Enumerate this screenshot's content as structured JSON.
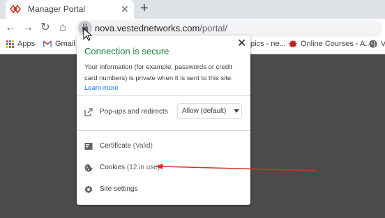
{
  "tab": {
    "title": "Manager Portal",
    "close": "✕"
  },
  "new_tab": "+",
  "toolbar": {
    "back": "←",
    "forward": "→",
    "reload": "↻",
    "home": "⌂"
  },
  "omnibox": {
    "domain": "nova.vestednetworks.com",
    "path": "/portal/"
  },
  "bookmarks": [
    {
      "label": "Apps"
    },
    {
      "label": "Gmail"
    },
    {
      "label": "pics - ne..."
    },
    {
      "label": "Online Courses - A..."
    },
    {
      "label": "V"
    }
  ],
  "popup": {
    "close": "✕",
    "title": "Connection is secure",
    "info": "Your information (for example, passwords or credit card numbers) is private when it is sent to this site.",
    "learn_more": "Learn more",
    "popups_label": "Pop-ups and redirects",
    "popups_value": "Allow (default)",
    "certificate_label": "Certificate",
    "certificate_status": "(Valid)",
    "cookies_label": "Cookies",
    "cookies_status": "(12 in use)",
    "site_settings_label": "Site settings"
  },
  "colors": {
    "secure_green": "#188038",
    "link_blue": "#1a73e8",
    "annotation_red": "#d93025",
    "page_background": "#4b4c4a"
  },
  "icons": [
    "favicon-icon",
    "close-icon",
    "plus-icon",
    "back-arrow-icon",
    "forward-arrow-icon",
    "reload-icon",
    "home-icon",
    "lock-icon",
    "apps-grid-icon",
    "gmail-icon",
    "bookmark-icon",
    "globe-icon",
    "open-external-icon",
    "certificate-icon",
    "cookie-icon",
    "gear-icon",
    "cursor-icon"
  ]
}
